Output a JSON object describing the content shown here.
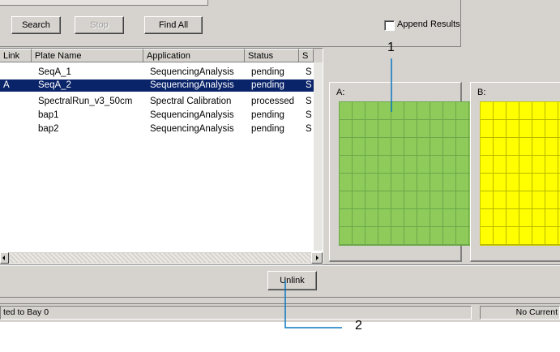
{
  "toolbar": {
    "search_label": "Search",
    "stop_label": "Stop",
    "find_all_label": "Find All",
    "append_results_label": "Append Results"
  },
  "table": {
    "columns": [
      "Link",
      "Plate Name",
      "Application",
      "Status",
      "S"
    ],
    "rows": [
      {
        "link": "",
        "plate": "SeqA_1",
        "app": "SequencingAnalysis",
        "status": "pending",
        "s": "S",
        "selected": false
      },
      {
        "link": "A",
        "plate": "SeqA_2",
        "app": "SequencingAnalysis",
        "status": "pending",
        "s": "S",
        "selected": true
      },
      {
        "link": "",
        "plate": "SpectralRun_v3_50cm",
        "app": "Spectral Calibration",
        "status": "processed",
        "s": "S",
        "selected": false
      },
      {
        "link": "",
        "plate": "bap1",
        "app": "SequencingAnalysis",
        "status": "pending",
        "s": "S",
        "selected": false
      },
      {
        "link": "",
        "plate": "bap2",
        "app": "SequencingAnalysis",
        "status": "pending",
        "s": "S",
        "selected": false
      }
    ]
  },
  "plates": [
    {
      "label": "A:",
      "color": "#8ecb5a"
    },
    {
      "label": "B:",
      "color": "#ffff00"
    }
  ],
  "unlink_label": "Unlink",
  "status": {
    "left": "ted to Bay 0",
    "right": "No Current"
  },
  "callouts": {
    "one": "1",
    "two": "2"
  }
}
